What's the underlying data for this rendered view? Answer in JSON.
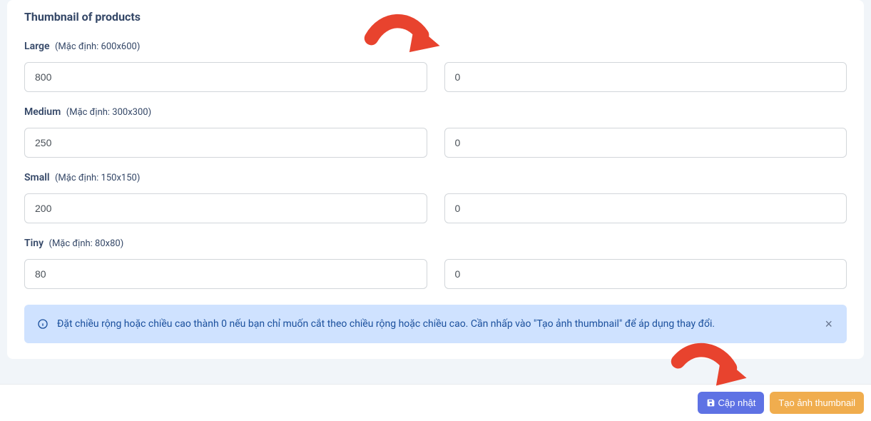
{
  "section": {
    "title": "Thumbnail of products"
  },
  "sizes": {
    "large": {
      "label": "Large",
      "hint": "(Mặc định: 600x600)",
      "w": "800",
      "h": "0"
    },
    "medium": {
      "label": "Medium",
      "hint": "(Mặc định: 300x300)",
      "w": "250",
      "h": "0"
    },
    "small": {
      "label": "Small",
      "hint": "(Mặc định: 150x150)",
      "w": "200",
      "h": "0"
    },
    "tiny": {
      "label": "Tiny",
      "hint": "(Mặc định: 80x80)",
      "w": "80",
      "h": "0"
    }
  },
  "alert": {
    "message": "Đặt chiều rộng hoặc chiều cao thành 0 nếu bạn chỉ muốn cắt theo chiều rộng hoặc chiều cao. Cần nhấp vào \"Tạo ảnh thumbnail\" để áp dụng thay đổi."
  },
  "footer": {
    "update_label": "Cập nhật",
    "generate_label": "Tạo ảnh thumbnail"
  }
}
